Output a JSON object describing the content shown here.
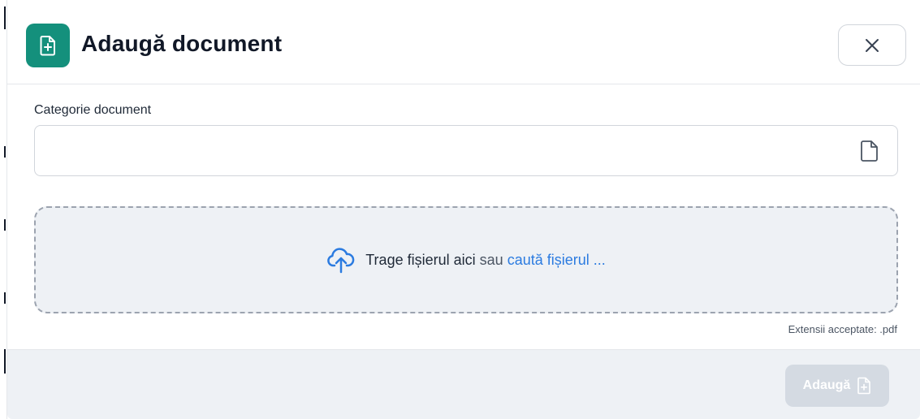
{
  "dialog": {
    "title": "Adaugă document",
    "header_icon": "file-plus-icon",
    "close_icon": "close-icon"
  },
  "form": {
    "category_label": "Categorie document",
    "category_value": "",
    "category_placeholder": "",
    "category_icon": "file-icon"
  },
  "dropzone": {
    "icon": "cloud-upload-icon",
    "text_main": "Trage fișierul aici",
    "text_or": "sau",
    "text_browse": "caută fișierul ...",
    "accepted_extensions": "Extensii acceptate: .pdf"
  },
  "footer": {
    "submit_label": "Adaugă",
    "submit_icon": "file-plus-icon",
    "submit_disabled": true
  },
  "colors": {
    "accent": "#14907c",
    "link": "#2b7be0",
    "disabled_button": "#d4dae2",
    "footer_bg": "#eef1f5"
  }
}
